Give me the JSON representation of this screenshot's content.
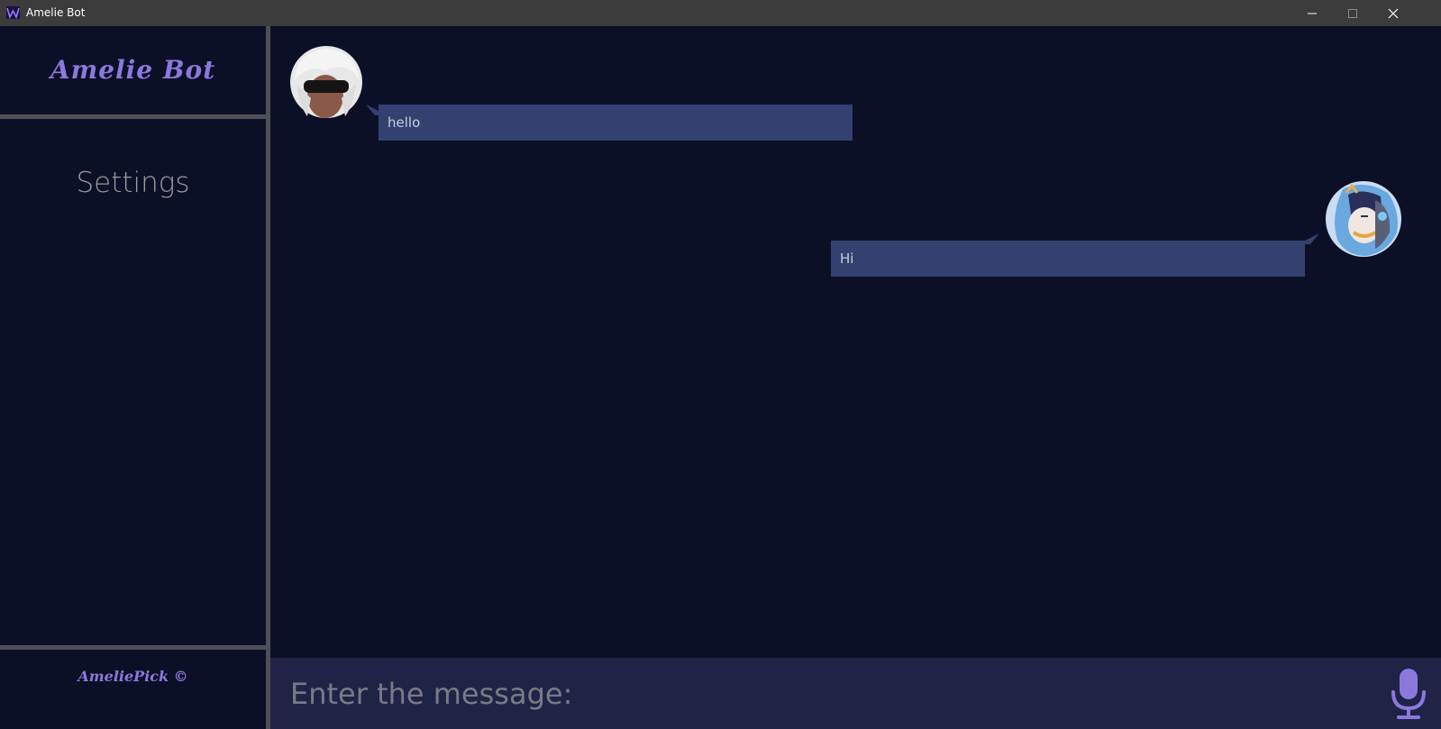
{
  "window": {
    "title": "Amelie Bot",
    "controls": {
      "minimize": "minimize-icon",
      "maximize": "maximize-icon",
      "close": "close-icon"
    }
  },
  "sidebar": {
    "brand": "Amelie Bot",
    "settings_label": "Settings",
    "footer": "AmeliePick ©"
  },
  "chat": {
    "messages": [
      {
        "sender": "bot",
        "text": "hello"
      },
      {
        "sender": "user",
        "text": "Hi"
      }
    ]
  },
  "input": {
    "placeholder": "Enter the message:",
    "value": "",
    "mic_icon": "microphone-icon"
  },
  "colors": {
    "background": "#0c1027",
    "bubble": "#334170",
    "accent": "#8c78dc",
    "input_bar": "#1f2447",
    "divider": "#4f4f57"
  }
}
